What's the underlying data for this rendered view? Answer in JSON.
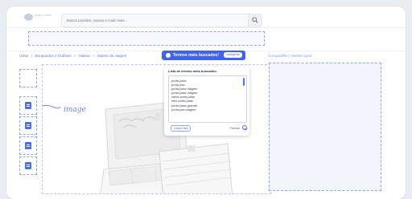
{
  "header": {
    "logo_text": "jóias e mais",
    "search": {
      "placeholder": "Buscar produtos, marcas e muito mais..."
    }
  },
  "breadcrumb": {
    "back": "Voltar",
    "items": [
      "Brinquedos e Hobbies",
      "Maleta",
      "Maleta de viagem"
    ]
  },
  "share": {
    "label": "Compartilhe | Vender igual"
  },
  "image_label": "image",
  "popup": {
    "header_title": "Termos mais buscados!",
    "header_badge": "Inteligente",
    "list_title": "Lista de termos mais buscados:",
    "terms": [
      "porta joias",
      "porta joia",
      "porta joias viagem",
      "porta joias viagem",
      "caixa porta joias",
      "mini porta joias",
      "porta joias grande",
      "porta joia viagem"
    ],
    "clear_button": "Limpar lista",
    "close_label": "Fechar"
  },
  "colors": {
    "accent": "#3f63f0",
    "dashed_border": "#8fa4f5",
    "link": "#5a7df0"
  }
}
